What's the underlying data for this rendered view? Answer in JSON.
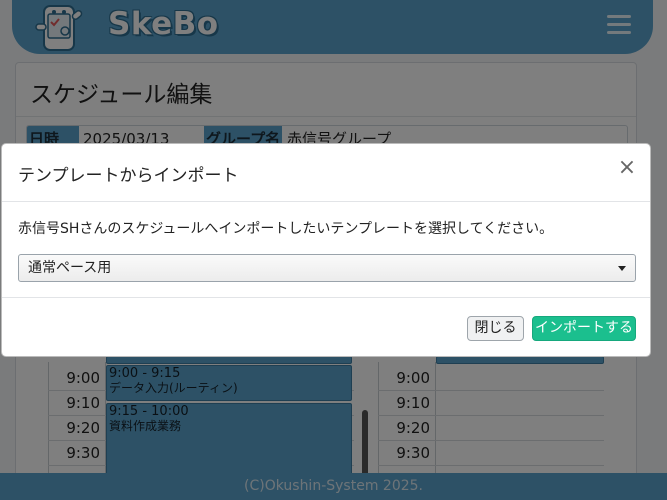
{
  "header": {
    "logo_text": "SkeBo",
    "menu_icon": "hamburger-menu-icon"
  },
  "card": {
    "title": "スケジュール編集",
    "date_label": "日時",
    "date_value": "2025/03/13",
    "group_label": "グループ名",
    "group_value": "赤信号グループ"
  },
  "schedule": {
    "left_times": [
      "9:00",
      "9:10",
      "9:20",
      "9:30"
    ],
    "right_times": [
      "9:00",
      "9:10",
      "9:20",
      "9:30"
    ],
    "events": [
      {
        "time": "9:00 - 9:15",
        "title": "データ入力(ルーティン)"
      },
      {
        "time": "9:15 - 10:00",
        "title": "資料作成業務"
      }
    ]
  },
  "modal": {
    "title": "テンプレートからインポート",
    "message": "赤信号SHさんのスケジュールへインポートしたいテンプレートを選択してください。",
    "selected_template": "通常ペース用",
    "close_button": "閉じる",
    "import_button": "インポートする"
  },
  "footer": {
    "copyright": "(C)Okushin-System 2025."
  },
  "colors": {
    "brand": "#5aa3cc",
    "import_button": "#1bbf8e"
  }
}
